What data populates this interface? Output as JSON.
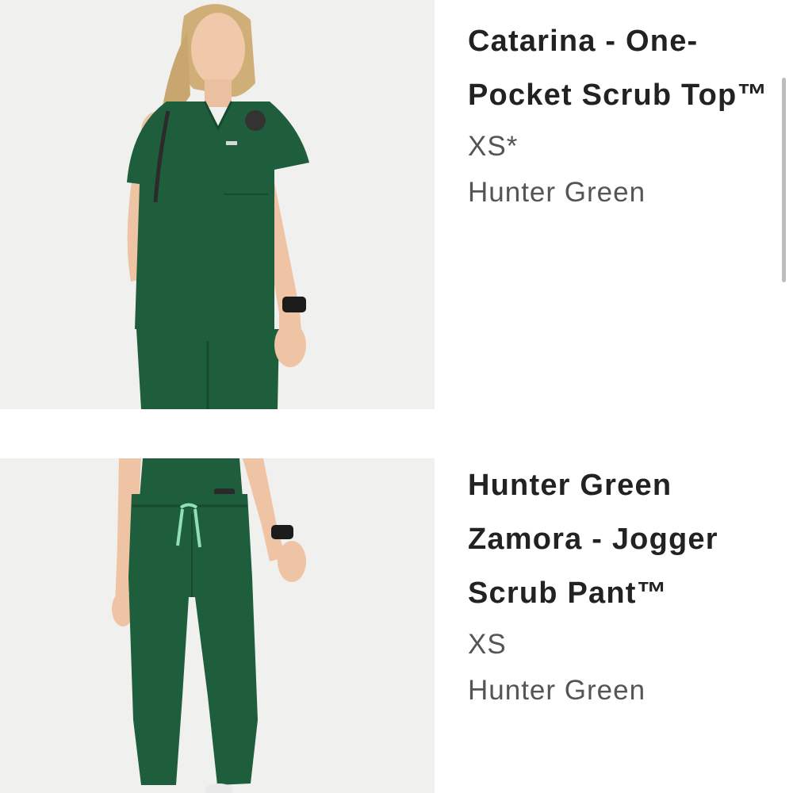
{
  "cart_items": [
    {
      "name": "Catarina - One-Pocket Scrub Top™",
      "size": "XS*",
      "color": "Hunter Green",
      "image_alt": "Woman wearing hunter green scrub top with stethoscope"
    },
    {
      "name": "Hunter Green Zamora - Jogger Scrub Pant™",
      "size": "XS",
      "color": "Hunter Green",
      "image_alt": "Hunter green jogger scrub pants"
    }
  ],
  "colors": {
    "scrub_green": "#1f5e3c",
    "text_primary": "#222222",
    "text_secondary": "#555555",
    "photo_bg": "#f0f0ef"
  }
}
